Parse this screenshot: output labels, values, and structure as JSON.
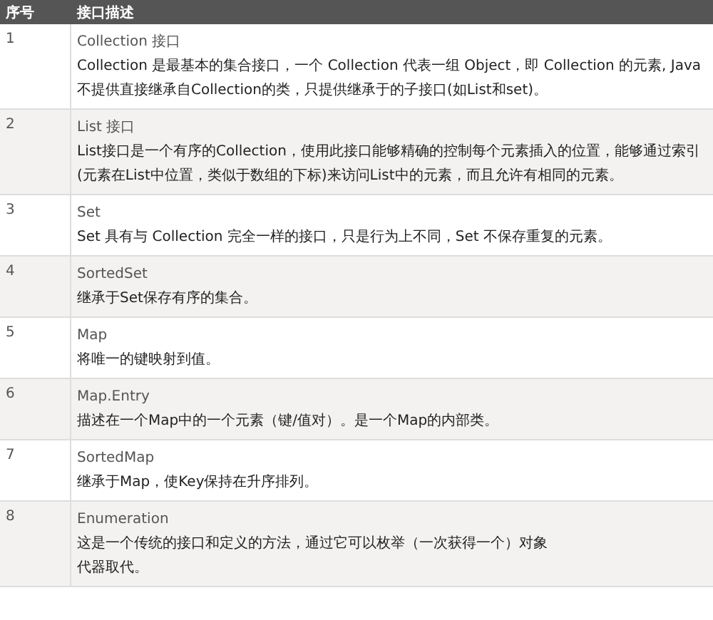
{
  "table": {
    "columns": [
      "序号",
      "接口描述"
    ],
    "rows": [
      {
        "number": "1",
        "title": "Collection 接口",
        "description": [
          "Collection 是最基本的集合接口，一个 Collection 代表一组 Object，即 Collection 的元素, Java不提供直接继承自Collection的类，只提供继承于的子接口(如List和set)。"
        ]
      },
      {
        "number": "2",
        "title": "List 接口",
        "description": [
          "List接口是一个有序的Collection，使用此接口能够精确的控制每个元素插入的位置，能够通过索引(元素在List中位置，类似于数组的下标)来访问List中的元素，而且允许有相同的元素。"
        ]
      },
      {
        "number": "3",
        "title": "Set",
        "description": [
          "Set 具有与 Collection 完全一样的接口，只是行为上不同，Set 不保存重复的元素。"
        ]
      },
      {
        "number": "4",
        "title": "SortedSet",
        "description": [
          "继承于Set保存有序的集合。"
        ]
      },
      {
        "number": "5",
        "title": "Map",
        "description": [
          "将唯一的键映射到值。"
        ]
      },
      {
        "number": "6",
        "title": "Map.Entry",
        "description": [
          "描述在一个Map中的一个元素（键/值对）。是一个Map的内部类。"
        ]
      },
      {
        "number": "7",
        "title": "SortedMap",
        "description": [
          "继承于Map，使Key保持在升序排列。"
        ]
      },
      {
        "number": "8",
        "title": "Enumeration",
        "description": [
          "这是一个传统的接口和定义的方法，通过它可以枚举（一次获得一个）对象",
          "代器取代。"
        ]
      }
    ]
  }
}
